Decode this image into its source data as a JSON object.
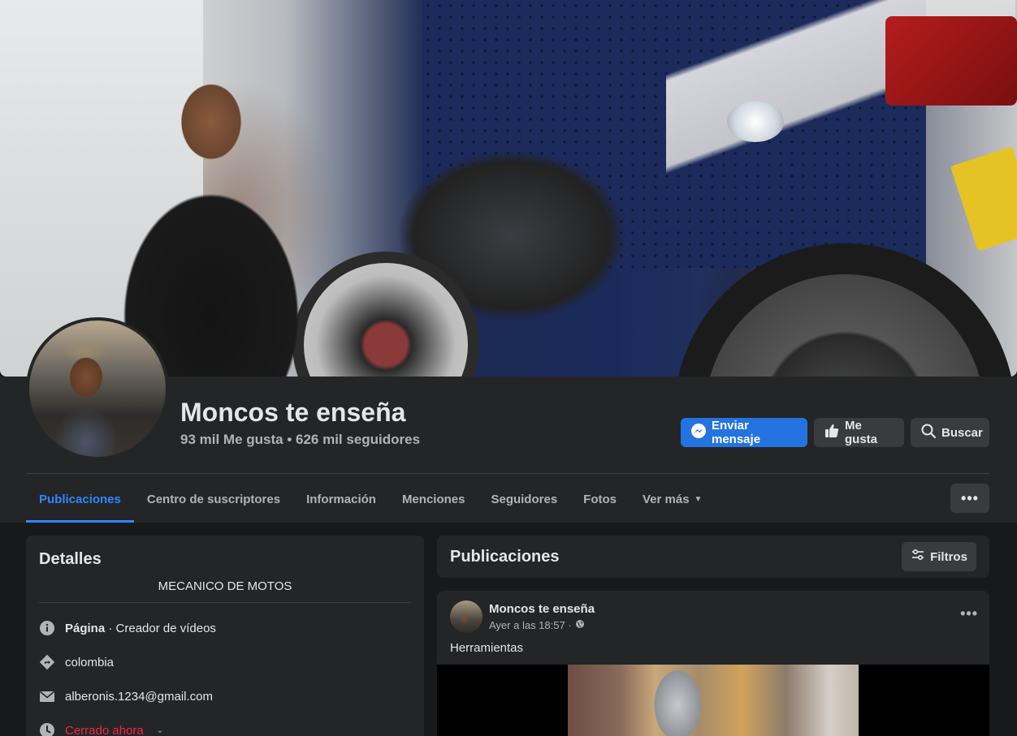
{
  "page": {
    "title": "Moncos te enseña",
    "stats": "93 mil Me gusta • 626 mil seguidores"
  },
  "actions": {
    "send_message": "Enviar mensaje",
    "like": "Me gusta",
    "search": "Buscar"
  },
  "tabs": [
    {
      "label": "Publicaciones",
      "active": true
    },
    {
      "label": "Centro de suscriptores"
    },
    {
      "label": "Información"
    },
    {
      "label": "Menciones"
    },
    {
      "label": "Seguidores"
    },
    {
      "label": "Fotos"
    },
    {
      "label": "Ver más"
    }
  ],
  "more_menu": "•••",
  "details": {
    "title": "Detalles",
    "bio": "MECANICO DE MOTOS",
    "category_label": "Página",
    "category_value": " · Creador de vídeos",
    "location": "colombia",
    "email": "alberonis.1234@gmail.com",
    "hours_status": "Cerrado ahora"
  },
  "posts_section": {
    "title": "Publicaciones",
    "filters_label": "Filtros"
  },
  "post": {
    "author": "Moncos te enseña",
    "time": "Ayer a las 18:57 ·",
    "text": "Herramientas",
    "menu": "•••"
  },
  "colors": {
    "accent": "#2d88ff",
    "primary_button": "#2374e1",
    "closed": "#f02849",
    "surface": "#242526",
    "background": "#18191a"
  },
  "icons": {
    "messenger": "messenger-icon",
    "like": "thumbs-up-icon",
    "search": "search-icon",
    "info": "info-icon",
    "location": "directions-icon",
    "email": "envelope-icon",
    "clock": "clock-icon",
    "filters": "sliders-icon",
    "privacy": "globe-icon"
  }
}
